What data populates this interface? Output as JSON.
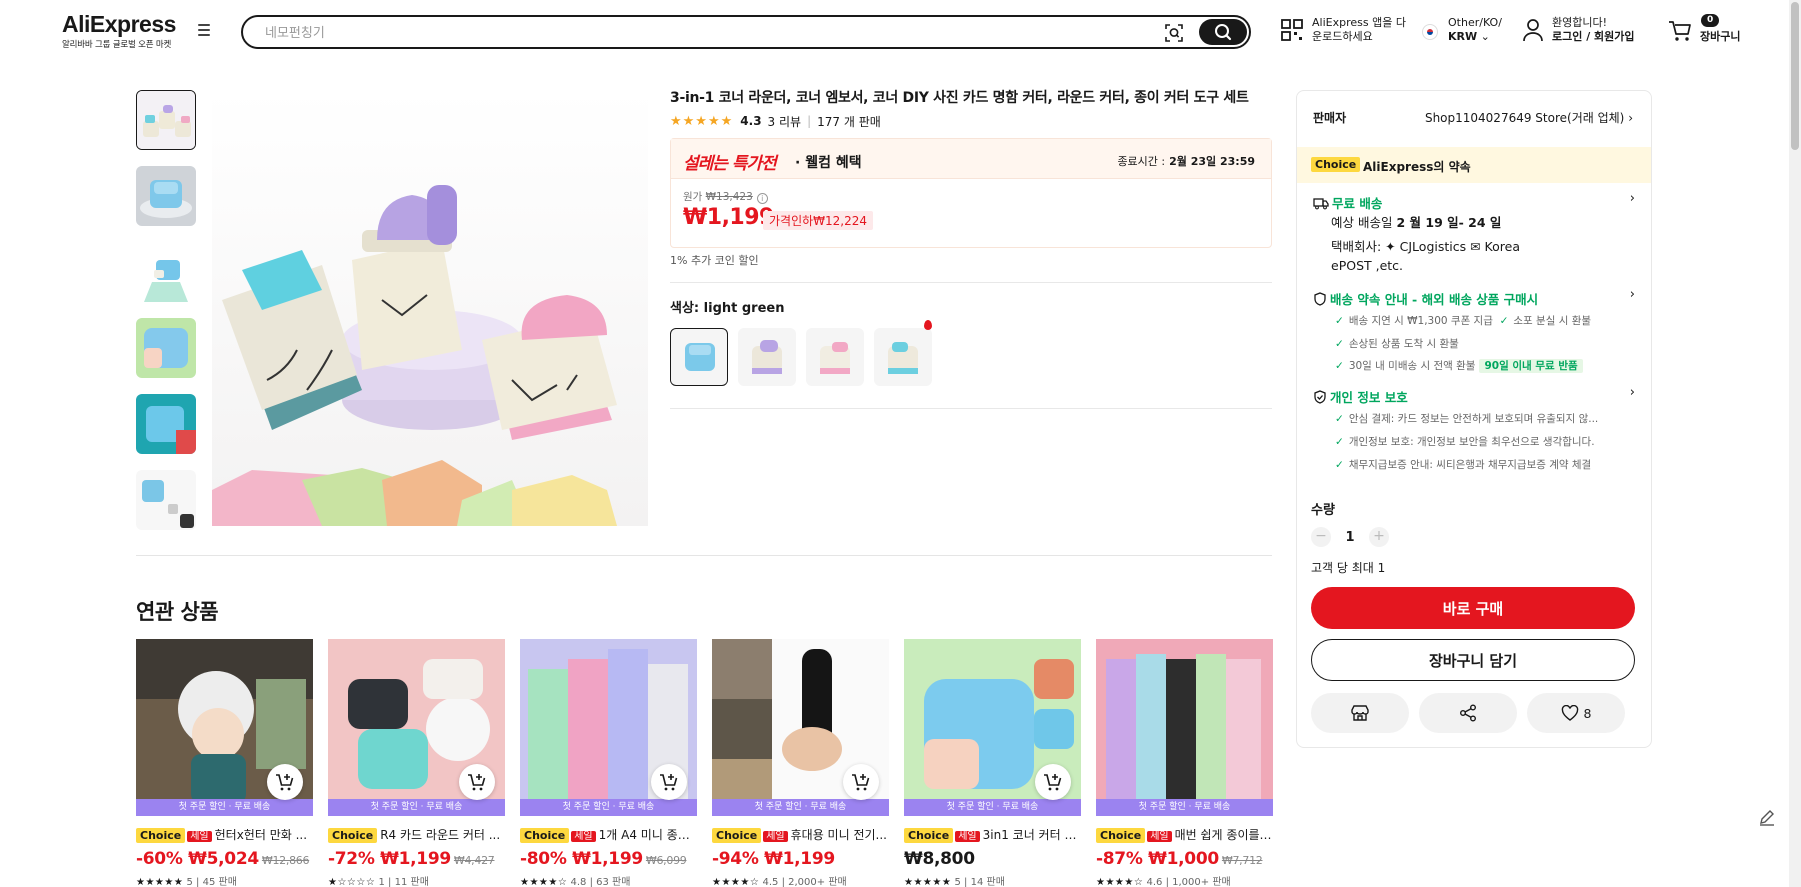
{
  "header": {
    "logo_text": "AliExpress",
    "logo_tagline": "알리바바 그룹 글로벌 오픈 마켓",
    "search_placeholder": "네모펀칭기",
    "app_line1": "AliExpress 앱을 다",
    "app_line2": "운로드하세요",
    "locale_line1": "Other/KO/",
    "locale_line2": "KRW",
    "account_line1": "환영합니다!",
    "account_line2": "로그인 / 회원가입",
    "cart_count": "0",
    "cart_label": "장바구니"
  },
  "product": {
    "title": "3-in-1 코너 라운더, 코너 엠보서, 코너 DIY 사진 카드 명함 커터, 라운드 커터, 종이 커터 도구 세트",
    "stars": "★★★★★",
    "rating": "4.3",
    "reviews": "3 리뷰",
    "sold": "177 개 판매",
    "deal_logo": "설레는 특가전",
    "deal_sub": "· 웰컴 혜택",
    "deal_end_label": "종료시간 :",
    "deal_end_time": "2월 23일 23:59",
    "orig_label": "원가",
    "orig_price": "₩13,423",
    "price": "₩1,199",
    "price_drop": "가격인하₩12,224",
    "coin_note": "1% 추가 코인 할인",
    "color_label": "색상:",
    "color_value": "light green"
  },
  "panel": {
    "seller_label": "판매자",
    "seller_name": "Shop1104027649 Store(거래 업체)",
    "promise_badge": "Choice",
    "promise_text": "AliExpress의 약속",
    "ship_title": "무료 배송",
    "ship_eta_label": "예상 배송일",
    "ship_eta": "2 월 19 일- 24 일",
    "ship_carrier_line1": "택배회사:  ✦  CJLogistics  ✉  Korea",
    "ship_carrier_line2": "ePOST ,etc.",
    "guarantee_title": "배송 약속 안내 - 해외 배송 상품 구매시",
    "g1a": "배송 지연 시 ₩1,300 쿠폰 지급",
    "g1b": "소포 분실 시 환불",
    "g2": "손상된 상품 도착 시 환불",
    "g3": "30일 내 미배송 시 전액 환불",
    "g3_badge": "90일 이내 무료 반품",
    "privacy_title": "개인 정보 보호",
    "p1": "안심 결제: 카드 정보는 안전하게 보호되며 유출되지 않...",
    "p2": "개인정보 보호: 개인정보 보안을 최우선으로 생각합니다.",
    "p3": "채무지급보증 안내: 씨티은행과 채무지급보증 계약 체결",
    "qty_label": "수량",
    "qty_value": "1",
    "qty_max": "고객 당 최대 1",
    "buy_now": "바로 구매",
    "add_cart": "장바구니 담기",
    "wish_count": "8"
  },
  "related": {
    "title": "연관 상품",
    "strip_text": "첫 주문 할인 · 무료 배송",
    "choice": "Choice",
    "sale": "세일",
    "items": [
      {
        "name": "헌터x헌터 만화 ...",
        "discount": "-60%",
        "price": "₩5,024",
        "orig": "₩12,866",
        "stars": "★★★★★",
        "meta": "5 | 45 판매"
      },
      {
        "name": "R4 카드 라운드 커터 ...",
        "discount": "-72%",
        "price": "₩1,199",
        "orig": "₩4,427",
        "stars": "★☆☆☆☆",
        "meta": "1 | 11 판매"
      },
      {
        "name": "1개 A4 미니 종이...",
        "discount": "-80%",
        "price": "₩1,199",
        "orig": "₩6,099",
        "stars": "★★★★☆",
        "meta": "4.8 | 63 판매"
      },
      {
        "name": "휴대용 미니 전기...",
        "discount": "-94%",
        "price": "₩1,199",
        "orig": "",
        "stars": "★★★★☆",
        "meta": "4.5 | 2,000+ 판매"
      },
      {
        "name": "3in1 코너 커터 종...",
        "discount": "",
        "price": "₩8,800",
        "orig": "",
        "stars": "★★★★★",
        "meta": "5 | 14 판매"
      },
      {
        "name": "매번 쉽게 종이를 자를...",
        "discount": "-87%",
        "price": "₩1,000",
        "orig": "₩7,712",
        "stars": "★★★★☆",
        "meta": "4.6 | 1,000+ 판매"
      }
    ]
  },
  "colors": {
    "accent_red": "#e4161f",
    "green": "#00a65e",
    "choice_yellow": "#fdd83f",
    "strip_purple": "#9b83f0"
  }
}
